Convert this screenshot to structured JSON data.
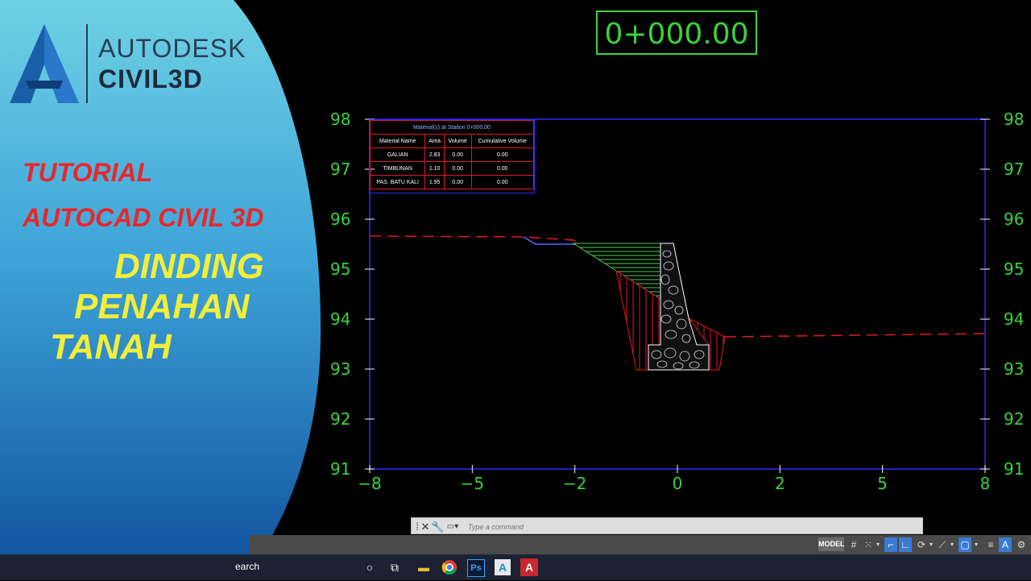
{
  "brand": {
    "line1": "AUTODESK",
    "line2": "CIVIL3D"
  },
  "promo": {
    "line1": "TUTORIAL",
    "line2": "AUTOCAD CIVIL 3D",
    "line3": "DINDING",
    "line4": "PENAHAN",
    "line5": "TANAH"
  },
  "station_label": "0+000.00",
  "material_table": {
    "title": "Material(s) at Station 0+000.00",
    "headers": [
      "Material Name",
      "Area",
      "Volume",
      "Cumulative Volume"
    ],
    "rows": [
      [
        "GALIAN",
        "2.83",
        "0.00",
        "0.00"
      ],
      [
        "TIMBUNAN",
        "1.10",
        "0.00",
        "0.00"
      ],
      [
        "PAS. BATU KALI",
        "1.95",
        "0.00",
        "0.00"
      ]
    ]
  },
  "chart_data": {
    "type": "section",
    "x_ticks": [
      "-8",
      "-5",
      "-2",
      "0",
      "2",
      "5",
      "8"
    ],
    "y_ticks": [
      "98",
      "97",
      "96",
      "95",
      "94",
      "93",
      "92",
      "91"
    ],
    "ylim": [
      91,
      98
    ],
    "xlim": [
      -8,
      8
    ]
  },
  "command_line": {
    "placeholder": "Type a command"
  },
  "statusbar": {
    "model_label": "MODEL"
  },
  "taskbar": {
    "search_text": "earch"
  },
  "colors": {
    "grid_text": "#3bd23b",
    "frame": "#2a2aff",
    "existing_ground": "#e01a22",
    "cut_hatch": "#4cd04c",
    "fill_hatch": "#e01a22"
  }
}
